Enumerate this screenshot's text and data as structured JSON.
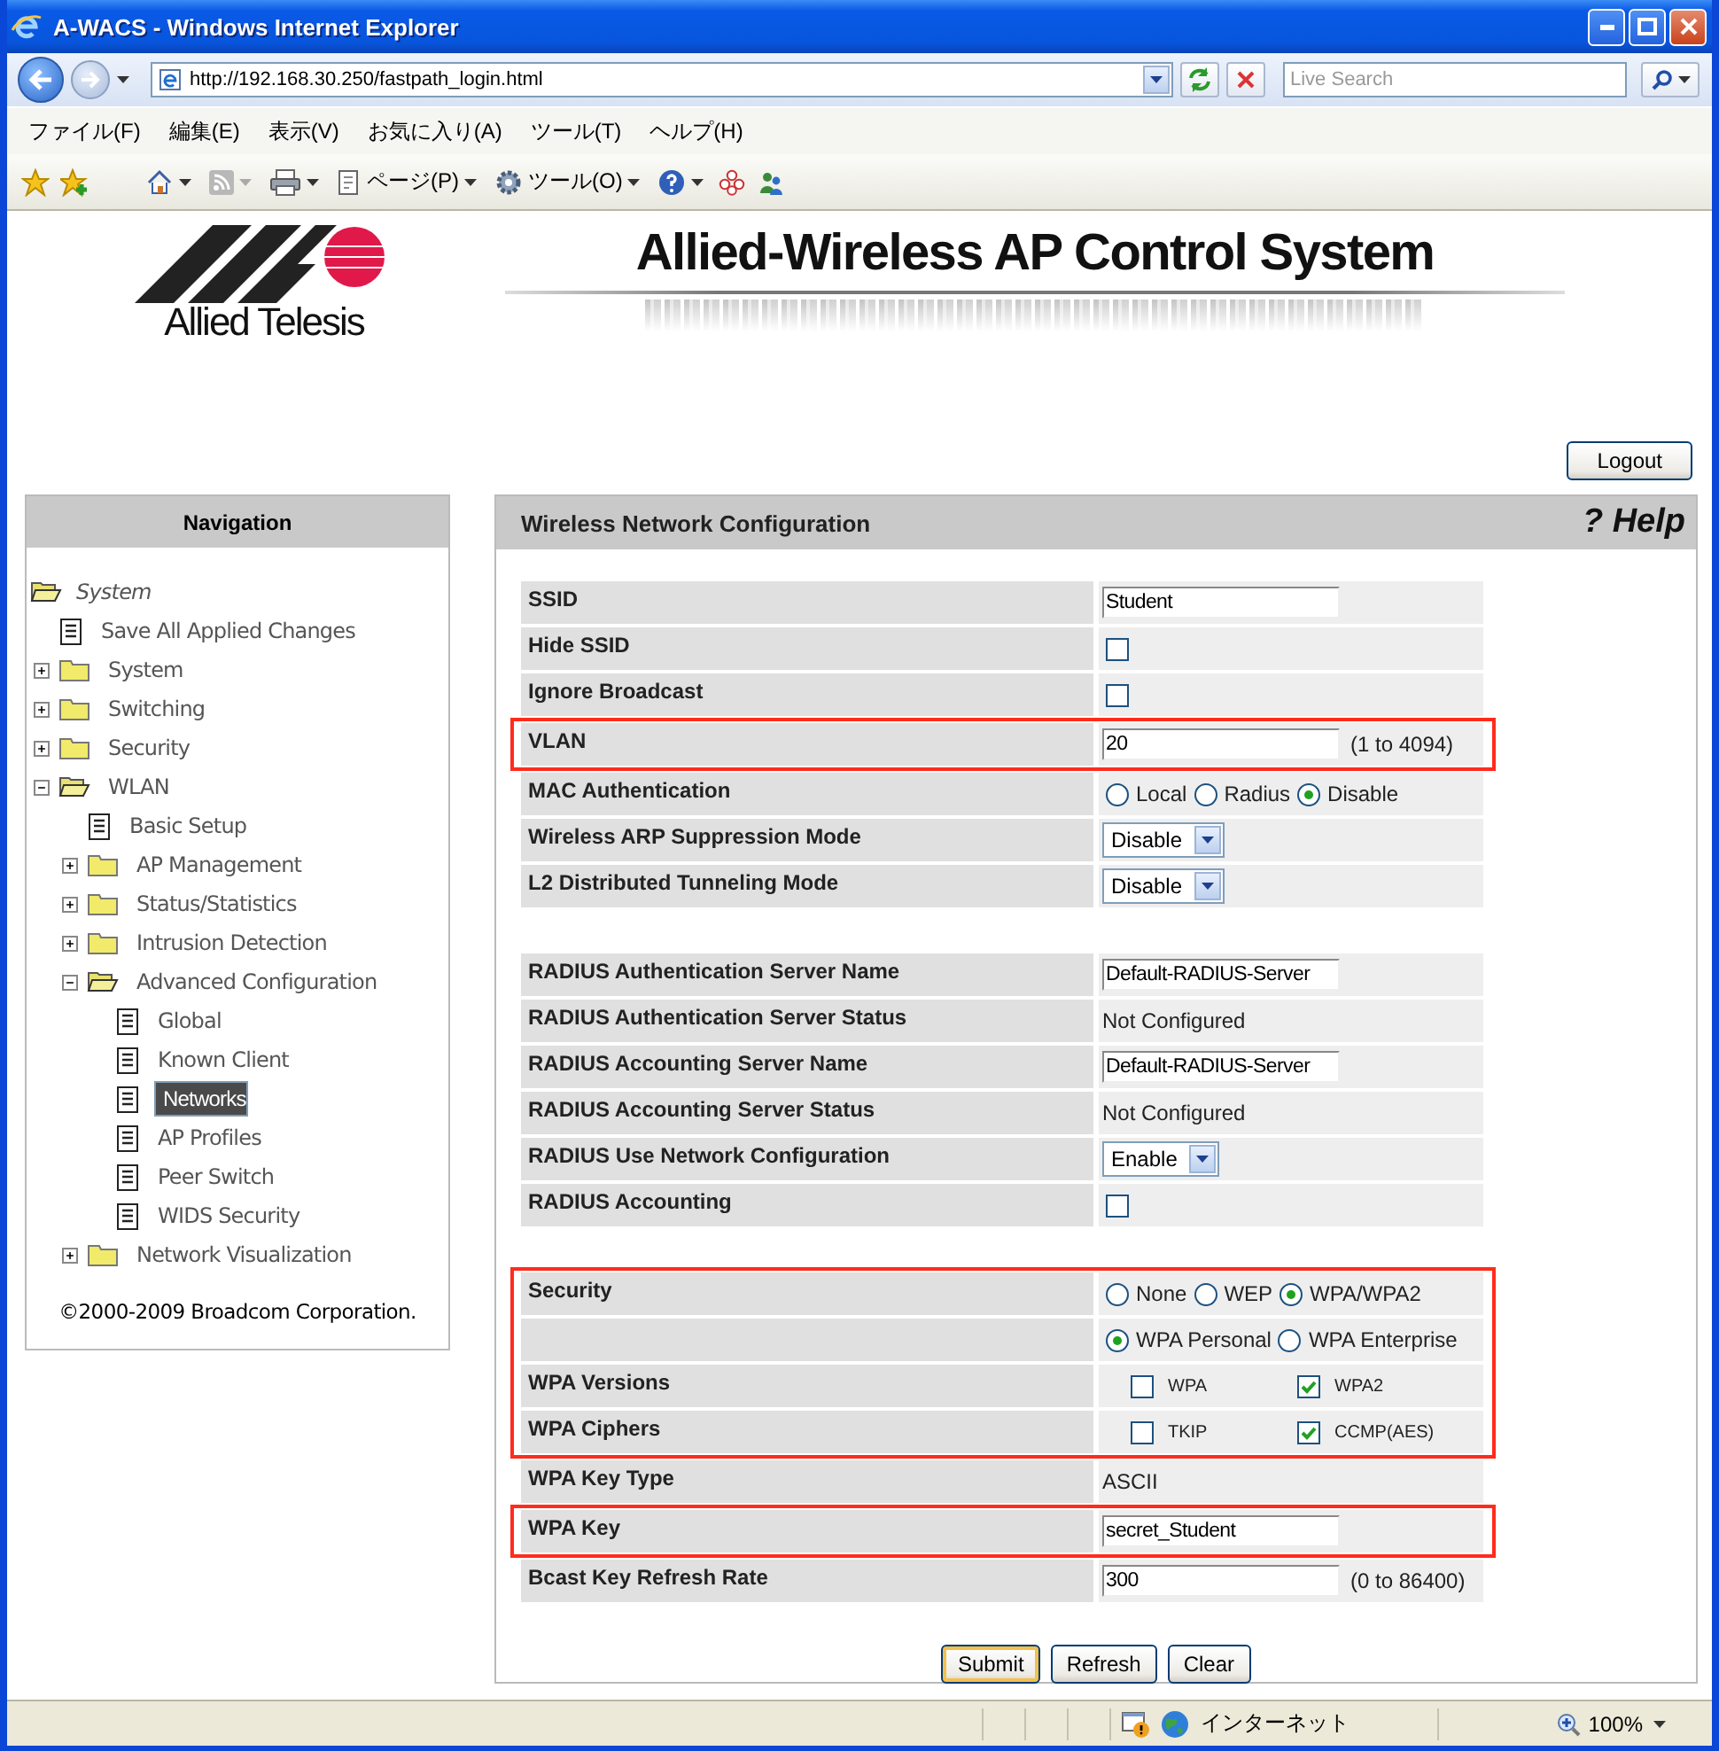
{
  "window": {
    "title": "A-WACS - Windows Internet Explorer"
  },
  "address_bar": {
    "url": "http://192.168.30.250/fastpath_login.html"
  },
  "search": {
    "placeholder": "Live Search"
  },
  "menu": [
    "ファイル(F)",
    "編集(E)",
    "表示(V)",
    "お気に入り(A)",
    "ツール(T)",
    "ヘルプ(H)"
  ],
  "toolbar": {
    "page_menu": "ページ(P)",
    "tools_menu": "ツール(O)"
  },
  "header": {
    "brand": "Allied Telesis",
    "title": "Allied-Wireless AP Control System"
  },
  "logout": "Logout",
  "navigation": {
    "title": "Navigation",
    "copyright": "©2000-2009 Broadcom Corporation.",
    "tree": [
      {
        "label": "System",
        "kind": "root",
        "expanded": true,
        "selected": false,
        "children": [
          {
            "label": "Save All Applied Changes",
            "kind": "page",
            "selected": false
          },
          {
            "label": "System",
            "kind": "folder",
            "expanded": false,
            "selected": false
          },
          {
            "label": "Switching",
            "kind": "folder",
            "expanded": false,
            "selected": false
          },
          {
            "label": "Security",
            "kind": "folder",
            "expanded": false,
            "selected": false
          },
          {
            "label": "WLAN",
            "kind": "folder",
            "expanded": true,
            "selected": false,
            "children": [
              {
                "label": "Basic Setup",
                "kind": "page",
                "selected": false
              },
              {
                "label": "AP Management",
                "kind": "folder",
                "expanded": false,
                "selected": false
              },
              {
                "label": "Status/Statistics",
                "kind": "folder",
                "expanded": false,
                "selected": false
              },
              {
                "label": "Intrusion Detection",
                "kind": "folder",
                "expanded": false,
                "selected": false
              },
              {
                "label": "Advanced Configuration",
                "kind": "folder",
                "expanded": true,
                "selected": false,
                "children": [
                  {
                    "label": "Global",
                    "kind": "page",
                    "selected": false
                  },
                  {
                    "label": "Known Client",
                    "kind": "page",
                    "selected": false
                  },
                  {
                    "label": "Networks",
                    "kind": "page",
                    "selected": true
                  },
                  {
                    "label": "AP Profiles",
                    "kind": "page",
                    "selected": false
                  },
                  {
                    "label": "Peer Switch",
                    "kind": "page",
                    "selected": false
                  },
                  {
                    "label": "WIDS Security",
                    "kind": "page",
                    "selected": false
                  }
                ]
              },
              {
                "label": "Network Visualization",
                "kind": "folder",
                "expanded": false,
                "selected": false
              }
            ]
          }
        ]
      }
    ]
  },
  "panel": {
    "title": "Wireless Network Configuration",
    "help": "? Help"
  },
  "sections": [
    {
      "groups": [
        {
          "highlighted": false,
          "rows": [
            {
              "label": "SSID",
              "kind": "input",
              "value": "Student"
            },
            {
              "label": "Hide SSID",
              "kind": "checkbox",
              "checked": false
            },
            {
              "label": "Ignore Broadcast",
              "kind": "checkbox",
              "checked": false
            }
          ]
        },
        {
          "highlighted": true,
          "rows": [
            {
              "label": "VLAN",
              "kind": "input",
              "value": "20",
              "hint": "(1 to 4094)"
            }
          ]
        },
        {
          "highlighted": false,
          "rows": [
            {
              "label": "MAC Authentication",
              "kind": "radio",
              "options": [
                {
                  "label": "Local",
                  "selected": false
                },
                {
                  "label": "Radius",
                  "selected": false
                },
                {
                  "label": "Disable",
                  "selected": true
                }
              ]
            },
            {
              "label": "Wireless ARP Suppression Mode",
              "kind": "select",
              "value": "Disable"
            },
            {
              "label": "L2 Distributed Tunneling Mode",
              "kind": "select",
              "value": "Disable"
            }
          ]
        }
      ]
    },
    {
      "groups": [
        {
          "highlighted": false,
          "rows": [
            {
              "label": "RADIUS Authentication Server Name",
              "kind": "input",
              "value": "Default-RADIUS-Server"
            },
            {
              "label": "RADIUS Authentication Server Status",
              "kind": "static",
              "value": "Not Configured"
            },
            {
              "label": "RADIUS Accounting Server Name",
              "kind": "input",
              "value": "Default-RADIUS-Server"
            },
            {
              "label": "RADIUS Accounting Server Status",
              "kind": "static",
              "value": "Not Configured"
            },
            {
              "label": "RADIUS Use Network Configuration",
              "kind": "select",
              "value": "Enable"
            },
            {
              "label": "RADIUS Accounting",
              "kind": "checkbox",
              "checked": false
            }
          ]
        }
      ]
    },
    {
      "groups": [
        {
          "highlighted": true,
          "rows": [
            {
              "label": "Security",
              "kind": "radio",
              "options": [
                {
                  "label": "None",
                  "selected": false
                },
                {
                  "label": "WEP",
                  "selected": false
                },
                {
                  "label": "WPA/WPA2",
                  "selected": true
                }
              ]
            },
            {
              "kind": "radio",
              "options": [
                {
                  "label": "WPA Personal",
                  "selected": true
                },
                {
                  "label": "WPA Enterprise",
                  "selected": false
                }
              ]
            },
            {
              "label": "WPA Versions",
              "kind": "checks",
              "options": [
                {
                  "label": "WPA",
                  "checked": false
                },
                {
                  "label": "WPA2",
                  "checked": true
                }
              ]
            },
            {
              "label": "WPA Ciphers",
              "kind": "checks",
              "options": [
                {
                  "label": "TKIP",
                  "checked": false
                },
                {
                  "label": "CCMP(AES)",
                  "checked": true
                }
              ]
            }
          ]
        },
        {
          "highlighted": false,
          "rows": [
            {
              "label": "WPA Key Type",
              "kind": "static",
              "value": "ASCII"
            }
          ]
        },
        {
          "highlighted": true,
          "rows": [
            {
              "label": "WPA Key",
              "kind": "input",
              "value": "secret_Student"
            }
          ]
        },
        {
          "highlighted": false,
          "rows": [
            {
              "label": "Bcast Key Refresh Rate",
              "kind": "input",
              "value": "300",
              "hint": "(0 to 86400)"
            }
          ]
        }
      ]
    }
  ],
  "buttons": [
    {
      "label": "Submit",
      "focused": true
    },
    {
      "label": "Refresh",
      "focused": false
    },
    {
      "label": "Clear",
      "focused": false
    }
  ],
  "status_bar": {
    "zone": "インターネット",
    "zoom": "100%"
  }
}
